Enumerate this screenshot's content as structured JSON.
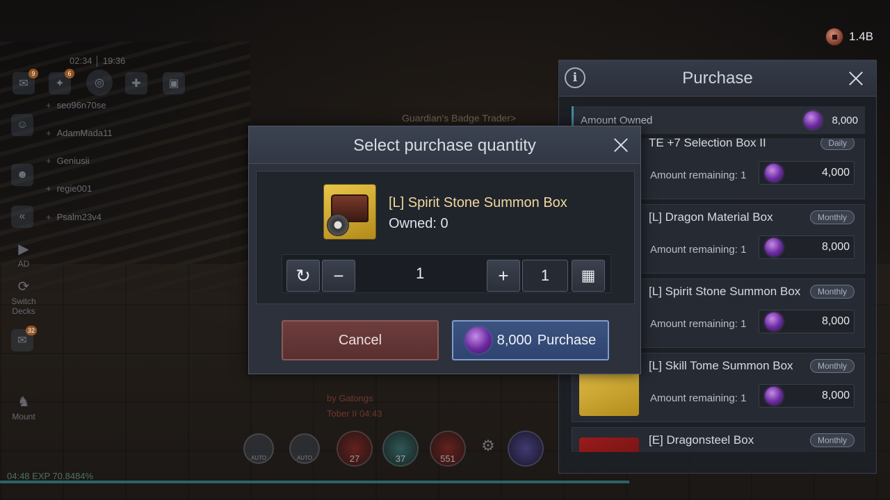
{
  "currency": {
    "amount": "1.4B"
  },
  "hud": {
    "timer_text": "02:34 │ 19:36",
    "friends": [
      "seo96n70se",
      "AdamMada11",
      "Geniusii",
      "regie001",
      "Psalm23v4"
    ],
    "left_buttons": [
      {
        "label": "AD",
        "icon": "play-icon"
      },
      {
        "label": "Switch Decks",
        "icon": "swap-icon"
      },
      {
        "label": "Mount",
        "icon": "mount-icon"
      }
    ],
    "badge_counts": [
      "9",
      "6",
      "32"
    ],
    "world_label": "Guardian's Badge Trader>",
    "chat_lines": [
      "by Gatongs",
      "Tober II  04:43"
    ],
    "skills": [
      {
        "label": "AUTO"
      },
      {
        "label": "AUTO"
      },
      {
        "count": "27"
      },
      {
        "count": "37"
      },
      {
        "count": "551"
      }
    ],
    "status_line": "04:48  EXP 70.8484%"
  },
  "panel": {
    "title": "Purchase",
    "amount_owned_label": "Amount Owned",
    "amount_owned_value": "8,000",
    "items": [
      {
        "name": "TE +7 Selection Box II",
        "tag": "Daily",
        "remaining": "Amount remaining: 1",
        "price": "4,000"
      },
      {
        "name": "[L] Dragon Material Box",
        "tag": "Monthly",
        "remaining": "Amount remaining: 1",
        "price": "8,000"
      },
      {
        "name": "[L] Spirit Stone Summon Box",
        "tag": "Monthly",
        "remaining": "Amount remaining: 1",
        "price": "8,000"
      },
      {
        "name": "[L] Skill Tome Summon Box",
        "tag": "Monthly",
        "remaining": "Amount remaining: 1",
        "price": "8,000"
      },
      {
        "name": "[E] Dragonsteel Box",
        "tag": "Monthly",
        "remaining": "",
        "price": ""
      }
    ]
  },
  "modal": {
    "title": "Select purchase quantity",
    "product_name": "[L] Spirit Stone Summon Box",
    "product_owned": "Owned: 0",
    "quantity": "1",
    "max_quantity": "1",
    "cancel_label": "Cancel",
    "purchase_price": "8,000",
    "purchase_label": "Purchase"
  },
  "colors": {
    "accent_blue": "#3c5380",
    "cancel_red": "#6e3d3d",
    "gem_purple": "#6b2aa0",
    "product_gold": "#e8c64a"
  }
}
